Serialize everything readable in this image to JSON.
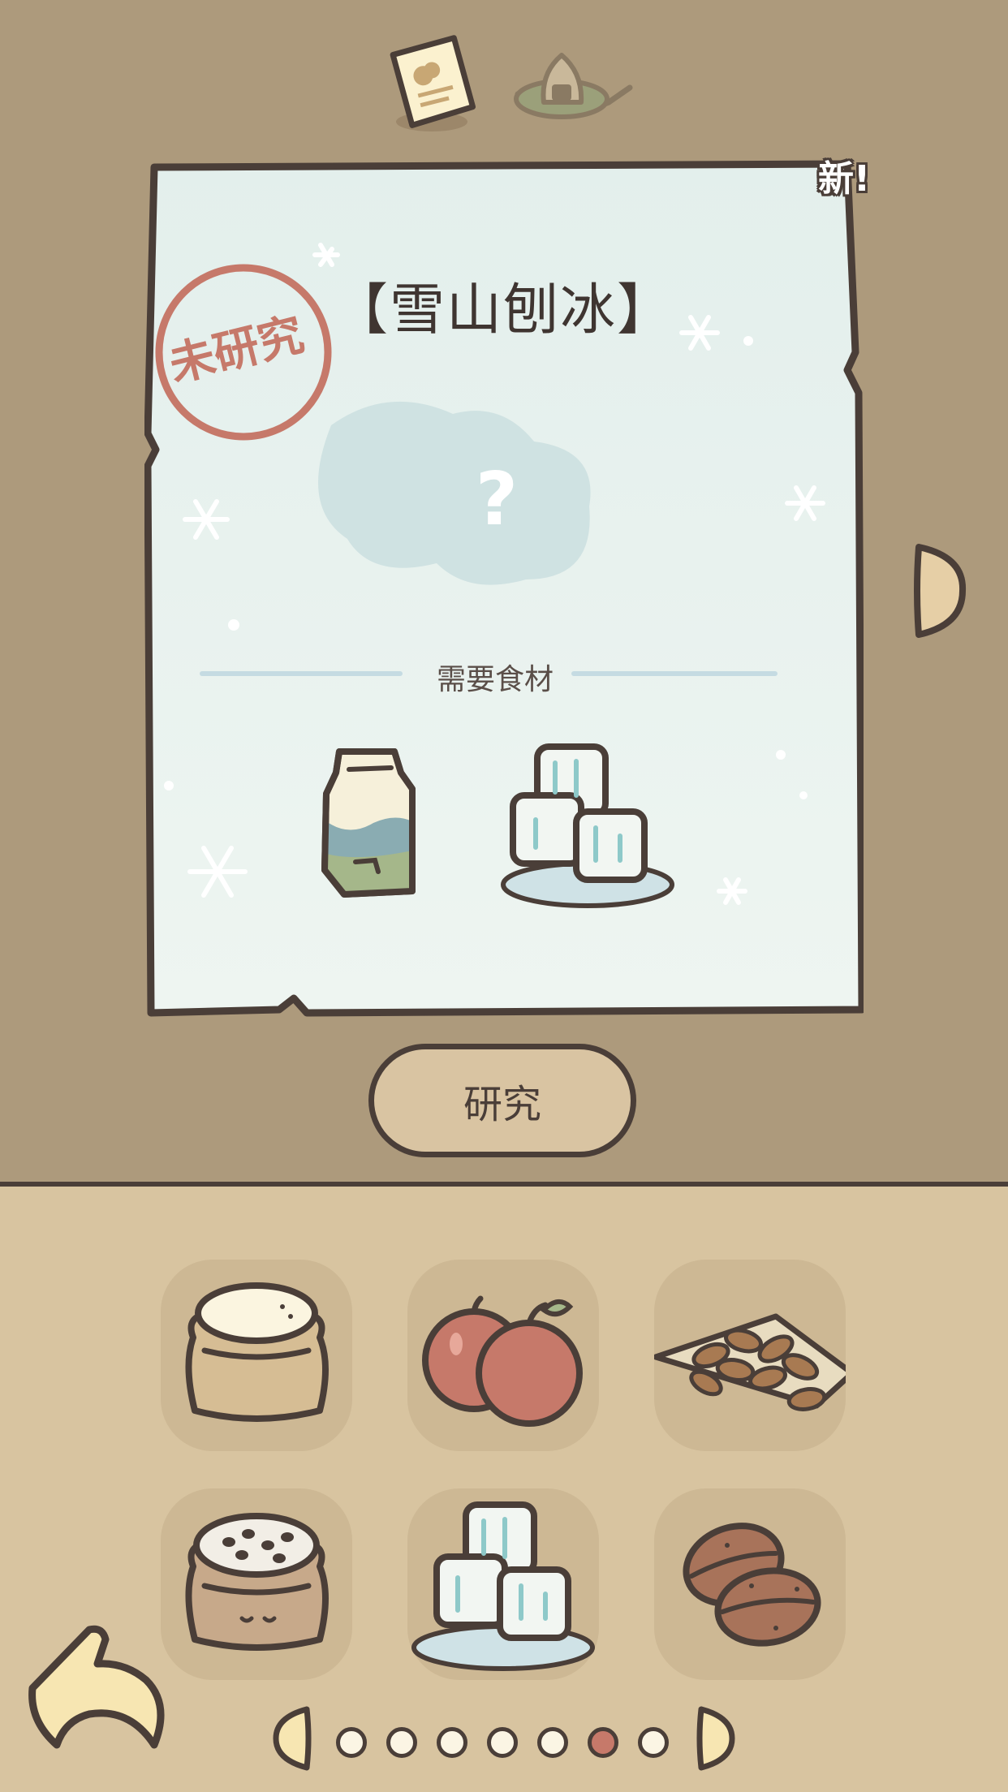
{
  "header": {
    "tabs": [
      {
        "name": "recipe-note",
        "icon": "paper-note-icon"
      },
      {
        "name": "onigiri-dish",
        "icon": "onigiri-plate-icon"
      }
    ]
  },
  "recipe_card": {
    "badge": "新!",
    "title": "【雪山刨冰】",
    "stamp_text": "未研究",
    "unknown_mark": "?",
    "required_label": "需要食材",
    "required_ingredients": [
      "milk-carton-icon",
      "ice-cubes-icon"
    ]
  },
  "actions": {
    "research_label": "研究"
  },
  "ingredients_grid": [
    {
      "name": "flour-sack-icon"
    },
    {
      "name": "apples-icon"
    },
    {
      "name": "almonds-icon"
    },
    {
      "name": "sesame-sack-icon"
    },
    {
      "name": "ice-cubes-icon"
    },
    {
      "name": "coffee-beans-icon"
    }
  ],
  "pagination": {
    "total": 7,
    "current": 6
  },
  "colors": {
    "background": "#ad9a7c",
    "panel": "#d8c4a0",
    "card": "#e8f2ef",
    "outline": "#4a3e38",
    "stamp": "#c6796a"
  }
}
